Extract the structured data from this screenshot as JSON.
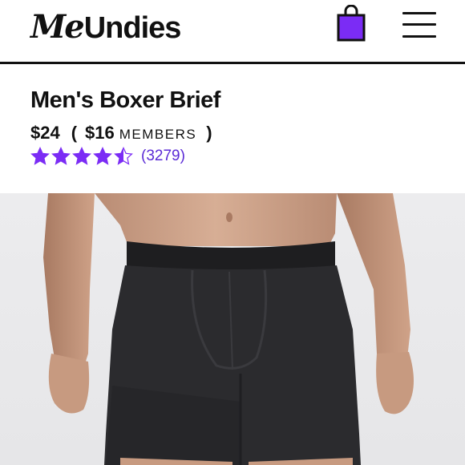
{
  "header": {
    "logo_part1": "Me",
    "logo_part2": "Undies",
    "accent_color": "#7b2cf5"
  },
  "product": {
    "title": "Men's Boxer Brief",
    "price": "$24",
    "paren_open": "(",
    "member_price": "$16",
    "members_label": "MEMBERS",
    "paren_close": ")",
    "rating": 4.5,
    "rating_max": 5,
    "review_count": "(3279)"
  },
  "icons": {
    "bag": "shopping-bag-icon",
    "menu": "hamburger-menu-icon",
    "star": "star-icon"
  }
}
